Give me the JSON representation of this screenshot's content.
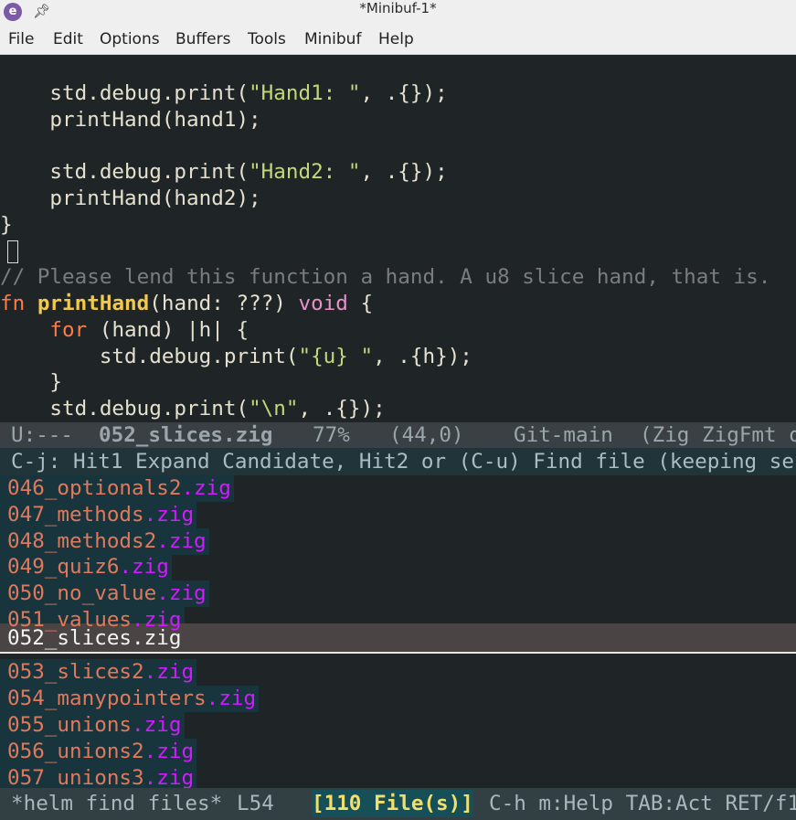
{
  "window": {
    "title": "*Minibuf-1*",
    "app_icon": "emacs-icon",
    "pin_icon": "pin-icon"
  },
  "menu": [
    "File",
    "Edit",
    "Options",
    "Buffers",
    "Tools",
    "Minibuf",
    "Help"
  ],
  "code": {
    "l1_a": "    std.debug.print(",
    "l1_s": "\"Hand1: \"",
    "l1_b": ", .{});",
    "l2": "    printHand(hand1);",
    "l4_a": "    std.debug.print(",
    "l4_s": "\"Hand2: \"",
    "l4_b": ", .{});",
    "l5": "    printHand(hand2);",
    "l6": "}",
    "l8": "// Please lend this function a hand. A u8 slice hand, that is.",
    "l9_kw": "fn",
    "l9_name": "printHand",
    "l9_args": "(hand: ???) ",
    "l9_type": "void",
    "l9_end": " {",
    "l10_pre": "    ",
    "l10_kw": "for",
    "l10_rest": " (hand) |h| {",
    "l11_a": "        std.debug.print(",
    "l11_s": "\"{u} \"",
    "l11_b": ", .{h});",
    "l12": "    }",
    "l13_a": "    std.debug.print(",
    "l13_s": "\"\\n\"",
    "l13_b": ", .{});"
  },
  "modeline": {
    "state": "U:---",
    "buffer": "052_slices.zig",
    "percent": "77%",
    "position": "(44,0)",
    "vc": "Git-main",
    "modes": "(Zig ZigFmt o"
  },
  "minibuffer_hint": "C-j: Hit1 Expand Candidate, Hit2 or (C-u) Find file (keeping se",
  "candidates": [
    {
      "base": "046_optionals2",
      "ext": ".zig"
    },
    {
      "base": "047_methods",
      "ext": ".zig"
    },
    {
      "base": "048_methods2",
      "ext": ".zig"
    },
    {
      "base": "049_quiz6",
      "ext": ".zig"
    },
    {
      "base": "050_no_value",
      "ext": ".zig"
    },
    {
      "base": "051_values",
      "ext": ".zig"
    },
    {
      "base": "052_slices",
      "ext": ".zig"
    },
    {
      "base": "053_slices2",
      "ext": ".zig"
    },
    {
      "base": "054_manypointers",
      "ext": ".zig"
    },
    {
      "base": "055_unions",
      "ext": ".zig"
    },
    {
      "base": "056_unions2",
      "ext": ".zig"
    },
    {
      "base": "057_unions3",
      "ext": ".zig"
    }
  ],
  "selected_candidate": "052_slices.zig",
  "helm_modeline": {
    "buffer": "*helm find files*",
    "line": "L54",
    "count": "[110 File(s)]",
    "help": "C-h m:Help TAB:Act RET/f1"
  },
  "colors": {
    "background": "#1f2527",
    "string": "#c3d879",
    "keyword": "#ff7b45",
    "function": "#f2c94c",
    "type": "#e991c8",
    "comment": "#7c7c7c",
    "candidate": "#e0795c",
    "extension": "#d01bff"
  }
}
